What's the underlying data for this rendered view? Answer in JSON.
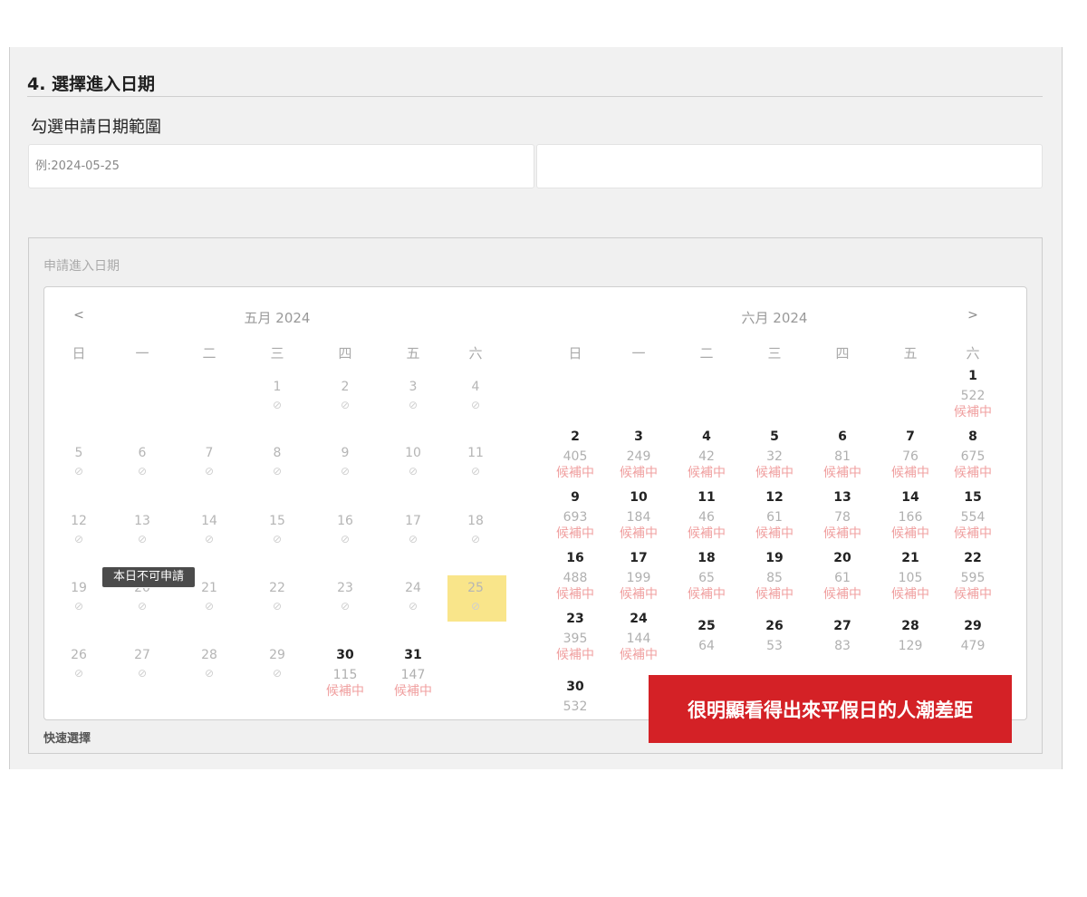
{
  "section": {
    "title": "4. 選擇進入日期",
    "subtitle": "勾選申請日期範圍"
  },
  "inputs": {
    "start_placeholder": "例:2024-05-25",
    "end_value": ""
  },
  "picker": {
    "label": "申請進入日期",
    "prev": "<",
    "next": ">",
    "quick_select": "快速選擇"
  },
  "weekdays": [
    "日",
    "一",
    "二",
    "三",
    "四",
    "五",
    "六"
  ],
  "months": [
    {
      "title": "五月 2024",
      "rows": [
        [
          null,
          null,
          null,
          {
            "day": "1",
            "disabled": true
          },
          {
            "day": "2",
            "disabled": true
          },
          {
            "day": "3",
            "disabled": true
          },
          {
            "day": "4",
            "disabled": true
          }
        ],
        [
          {
            "day": "5",
            "disabled": true
          },
          {
            "day": "6",
            "disabled": true
          },
          {
            "day": "7",
            "disabled": true
          },
          {
            "day": "8",
            "disabled": true
          },
          {
            "day": "9",
            "disabled": true
          },
          {
            "day": "10",
            "disabled": true
          },
          {
            "day": "11",
            "disabled": true
          }
        ],
        [
          {
            "day": "12",
            "disabled": true
          },
          {
            "day": "13",
            "disabled": true
          },
          {
            "day": "14",
            "disabled": true
          },
          {
            "day": "15",
            "disabled": true
          },
          {
            "day": "16",
            "disabled": true
          },
          {
            "day": "17",
            "disabled": true
          },
          {
            "day": "18",
            "disabled": true
          }
        ],
        [
          {
            "day": "19",
            "disabled": true
          },
          {
            "day": "20",
            "disabled": true
          },
          {
            "day": "21",
            "disabled": true
          },
          {
            "day": "22",
            "disabled": true
          },
          {
            "day": "23",
            "disabled": true
          },
          {
            "day": "24",
            "disabled": true
          },
          {
            "day": "25",
            "disabled": true,
            "selected": true
          }
        ],
        [
          {
            "day": "26",
            "disabled": true
          },
          {
            "day": "27",
            "disabled": true
          },
          {
            "day": "28",
            "disabled": true
          },
          {
            "day": "29",
            "disabled": true
          },
          {
            "day": "30",
            "count": "115",
            "status": "候補中"
          },
          {
            "day": "31",
            "count": "147",
            "status": "候補中"
          },
          null
        ]
      ]
    },
    {
      "title": "六月 2024",
      "rows": [
        [
          null,
          null,
          null,
          null,
          null,
          null,
          {
            "day": "1",
            "count": "522",
            "status": "候補中"
          }
        ],
        [
          {
            "day": "2",
            "count": "405",
            "status": "候補中"
          },
          {
            "day": "3",
            "count": "249",
            "status": "候補中"
          },
          {
            "day": "4",
            "count": "42",
            "status": "候補中"
          },
          {
            "day": "5",
            "count": "32",
            "status": "候補中"
          },
          {
            "day": "6",
            "count": "81",
            "status": "候補中"
          },
          {
            "day": "7",
            "count": "76",
            "status": "候補中"
          },
          {
            "day": "8",
            "count": "675",
            "status": "候補中"
          }
        ],
        [
          {
            "day": "9",
            "count": "693",
            "status": "候補中"
          },
          {
            "day": "10",
            "count": "184",
            "status": "候補中"
          },
          {
            "day": "11",
            "count": "46",
            "status": "候補中"
          },
          {
            "day": "12",
            "count": "61",
            "status": "候補中"
          },
          {
            "day": "13",
            "count": "78",
            "status": "候補中"
          },
          {
            "day": "14",
            "count": "166",
            "status": "候補中"
          },
          {
            "day": "15",
            "count": "554",
            "status": "候補中"
          }
        ],
        [
          {
            "day": "16",
            "count": "488",
            "status": "候補中"
          },
          {
            "day": "17",
            "count": "199",
            "status": "候補中"
          },
          {
            "day": "18",
            "count": "65",
            "status": "候補中"
          },
          {
            "day": "19",
            "count": "85",
            "status": "候補中"
          },
          {
            "day": "20",
            "count": "61",
            "status": "候補中"
          },
          {
            "day": "21",
            "count": "105",
            "status": "候補中"
          },
          {
            "day": "22",
            "count": "595",
            "status": "候補中"
          }
        ],
        [
          {
            "day": "23",
            "count": "395",
            "status": "候補中"
          },
          {
            "day": "24",
            "count": "144",
            "status": "候補中"
          },
          {
            "day": "25",
            "count": "64"
          },
          {
            "day": "26",
            "count": "53"
          },
          {
            "day": "27",
            "count": "83"
          },
          {
            "day": "28",
            "count": "129"
          },
          {
            "day": "29",
            "count": "479"
          }
        ],
        [
          {
            "day": "30",
            "count": "532"
          },
          null,
          null,
          null,
          null,
          null,
          null
        ]
      ]
    }
  ],
  "tooltip": "本日不可申請",
  "disabled_icon": "⊘",
  "banner": "很明顯看得出來平假日的人潮差距",
  "colors": {
    "accent_red": "#d42126",
    "selected_day": "#f9e58a",
    "status_text": "#f0a0a0"
  }
}
